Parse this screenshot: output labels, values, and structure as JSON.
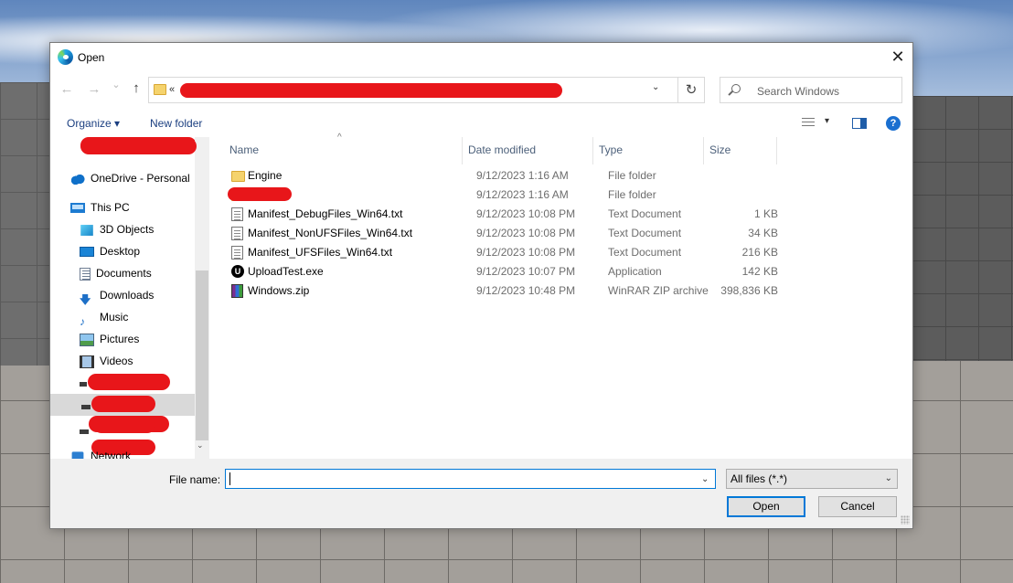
{
  "dialog": {
    "title": "Open",
    "close_glyph": "✕"
  },
  "nav": {
    "back_glyph": "←",
    "forward_glyph": "→",
    "recent_glyph": "⌄",
    "up_glyph": "↑",
    "address_prefix": "«",
    "refresh_glyph": "↻",
    "dropdown_glyph": "⌄",
    "search_placeholder": "Search Windows"
  },
  "toolbar": {
    "organize_label": "Organize ▾",
    "new_folder_label": "New folder",
    "view_dropdown_glyph": "▾",
    "help_glyph": "?"
  },
  "sidebar": {
    "items": [
      {
        "label": "OneDrive - Personal",
        "icon": "cloud-icon"
      },
      {
        "label": "This PC",
        "icon": "computer-icon"
      },
      {
        "label": "3D Objects",
        "icon": "cube-icon"
      },
      {
        "label": "Desktop",
        "icon": "desktop-icon"
      },
      {
        "label": "Documents",
        "icon": "documents-icon"
      },
      {
        "label": "Downloads",
        "icon": "download-arrow-icon",
        "glyph": "🡇"
      },
      {
        "label": "Music",
        "icon": "music-note-icon",
        "glyph": "♪"
      },
      {
        "label": "Pictures",
        "icon": "pictures-icon"
      },
      {
        "label": "Videos",
        "icon": "film-icon"
      },
      {
        "label": "Network",
        "icon": "network-icon"
      }
    ],
    "scroll_down_glyph": "⌄"
  },
  "columns": {
    "name": "Name",
    "date": "Date modified",
    "type": "Type",
    "size": "Size",
    "sort_glyph": "^"
  },
  "files": [
    {
      "name": "Engine",
      "date": "9/12/2023 1:16 AM",
      "type": "File folder",
      "size": "",
      "icon": "folder-icon"
    },
    {
      "name": "",
      "date": "9/12/2023 1:16 AM",
      "type": "File folder",
      "size": "",
      "icon": "folder-icon"
    },
    {
      "name": "Manifest_DebugFiles_Win64.txt",
      "date": "9/12/2023 10:08 PM",
      "type": "Text Document",
      "size": "1 KB",
      "icon": "text-file-icon"
    },
    {
      "name": "Manifest_NonUFSFiles_Win64.txt",
      "date": "9/12/2023 10:08 PM",
      "type": "Text Document",
      "size": "34 KB",
      "icon": "text-file-icon"
    },
    {
      "name": "Manifest_UFSFiles_Win64.txt",
      "date": "9/12/2023 10:08 PM",
      "type": "Text Document",
      "size": "216 KB",
      "icon": "text-file-icon"
    },
    {
      "name": "UploadTest.exe",
      "date": "9/12/2023 10:07 PM",
      "type": "Application",
      "size": "142 KB",
      "icon": "unreal-engine-icon",
      "icon_glyph": "U"
    },
    {
      "name": "Windows.zip",
      "date": "9/12/2023 10:48 PM",
      "type": "WinRAR ZIP archive",
      "size": "398,836 KB",
      "icon": "winrar-archive-icon"
    }
  ],
  "bottom": {
    "file_name_label": "File name:",
    "file_name_value": "",
    "file_name_dd": "⌄",
    "filter_value": "All files (*.*)",
    "filter_dd": "⌄",
    "open_label": "Open",
    "cancel_label": "Cancel"
  },
  "colors": {
    "accent": "#0078d7",
    "redaction": "#e8161a",
    "link_text": "#1b3f80"
  }
}
